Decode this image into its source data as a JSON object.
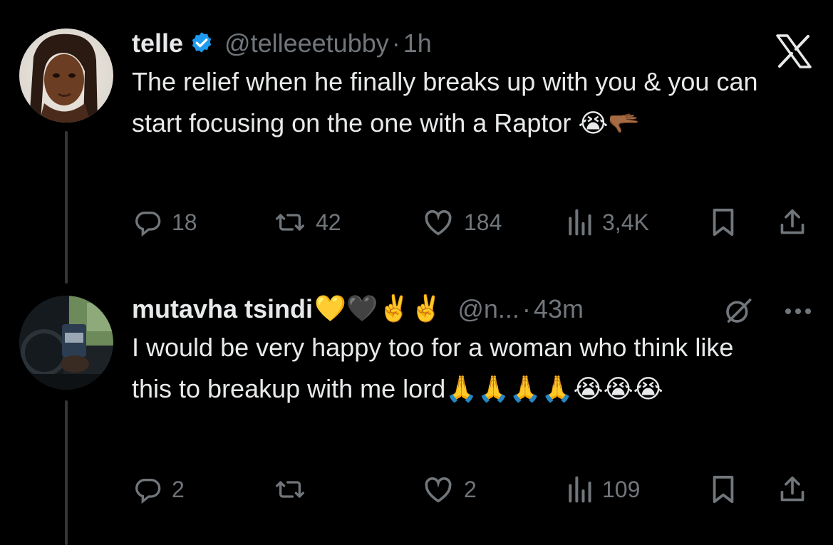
{
  "tweet1": {
    "display_name": "telle",
    "handle": "@telleeetubby",
    "dot": "·",
    "time": "1h",
    "text": "The relief when he finally breaks up with you & you can start focusing on the one with a Raptor 😭🫳🏾",
    "replies": "18",
    "reposts": "42",
    "likes": "184",
    "views": "3,4K"
  },
  "tweet2": {
    "display_name": "mutavha tsindi",
    "name_emojis": "💛🖤✌️✌️",
    "handle": "@n...",
    "dot": "·",
    "time": "43m",
    "text": "I would be very happy too for a woman who think like this to breakup with me lord🙏🙏🙏🙏😭😭😭",
    "replies": "2",
    "reposts": "",
    "likes": "2",
    "views": "109"
  },
  "colors": {
    "background": "#000000",
    "text": "#e7e9ea",
    "muted": "#71767b",
    "verified": "#1d9bf0",
    "thread_line": "#333639"
  },
  "icons": [
    "x-logo-icon",
    "verified-badge-icon",
    "reply-icon",
    "repost-icon",
    "like-icon",
    "views-icon",
    "bookmark-icon",
    "share-icon",
    "grok-icon",
    "more-icon"
  ]
}
